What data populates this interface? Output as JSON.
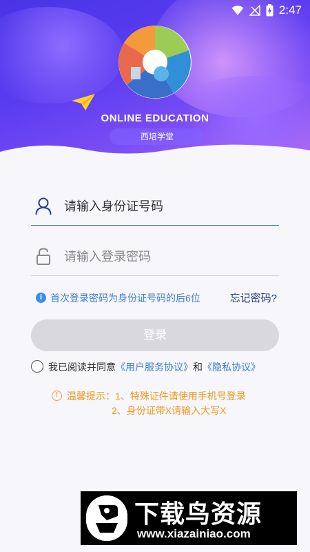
{
  "status_bar": {
    "time": "2:47"
  },
  "brand": {
    "title": "ONLINE EDUCATION",
    "subtitle": "西培学堂"
  },
  "login_form": {
    "username_placeholder": "请输入身份证号码",
    "password_placeholder": "请输入登录密码",
    "hint": "首次登录密码为身份证号码的后6位",
    "forgot_password": "忘记密码?",
    "login_button": "登录"
  },
  "agreement": {
    "prefix": "我已阅读并同意",
    "user_agreement": "《用户服务协议》",
    "and": "和",
    "privacy_policy": "《隐私协议》"
  },
  "tips": {
    "line1": "温馨提示：1、特殊证件请使用手机号登录",
    "line2": "2、身份证带X请输入大写X"
  },
  "watermark": {
    "title": "下载鸟资源",
    "url": "www.xiazainiao.com"
  },
  "colors": {
    "header_gradient_start": "#4a34e6",
    "header_gradient_end": "#b06cf3",
    "link_blue": "#3a7fd6",
    "tip_orange": "#f09a20",
    "button_disabled": "#d9d9dd"
  }
}
